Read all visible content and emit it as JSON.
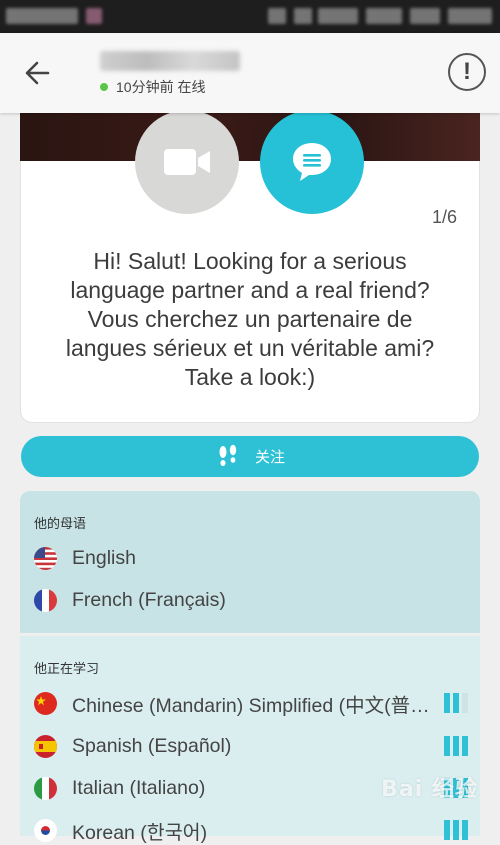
{
  "header": {
    "status_text": "10分钟前 在线",
    "report_icon_label": "!"
  },
  "card": {
    "page_indicator": "1/6",
    "bio": "Hi! Salut! Looking for a serious\nlanguage partner and a real friend?\nVous cherchez un partenaire de\nlangues sérieux et un véritable ami?\nTake a look:)"
  },
  "follow_button": {
    "label": "关注",
    "icon": "footprints-icon"
  },
  "native": {
    "title": "他的母语",
    "languages": [
      {
        "name": "English",
        "flag": "us-flag-icon"
      },
      {
        "name": "French (Français)",
        "flag": "france-flag-icon"
      }
    ]
  },
  "learning": {
    "title": "他正在学习",
    "languages": [
      {
        "name": "Chinese (Mandarin) Simplified (中文(普通话)简体)",
        "flag": "china-flag-icon",
        "level": 2,
        "max_level": 3
      },
      {
        "name": "Spanish (Español)",
        "flag": "spain-flag-icon",
        "level": 3,
        "max_level": 3
      },
      {
        "name": "Italian (Italiano)",
        "flag": "italy-flag-icon",
        "level": 3,
        "max_level": 3
      },
      {
        "name": "Korean (한국어)",
        "flag": "korea-flag-icon",
        "level": 3,
        "max_level": 3
      }
    ]
  },
  "colors": {
    "accent": "#2ec1d6",
    "native_bg": "#c7e3e6",
    "learning_bg": "#daeef0",
    "online_dot": "#5cc44b"
  },
  "watermark": "Bai 经验"
}
